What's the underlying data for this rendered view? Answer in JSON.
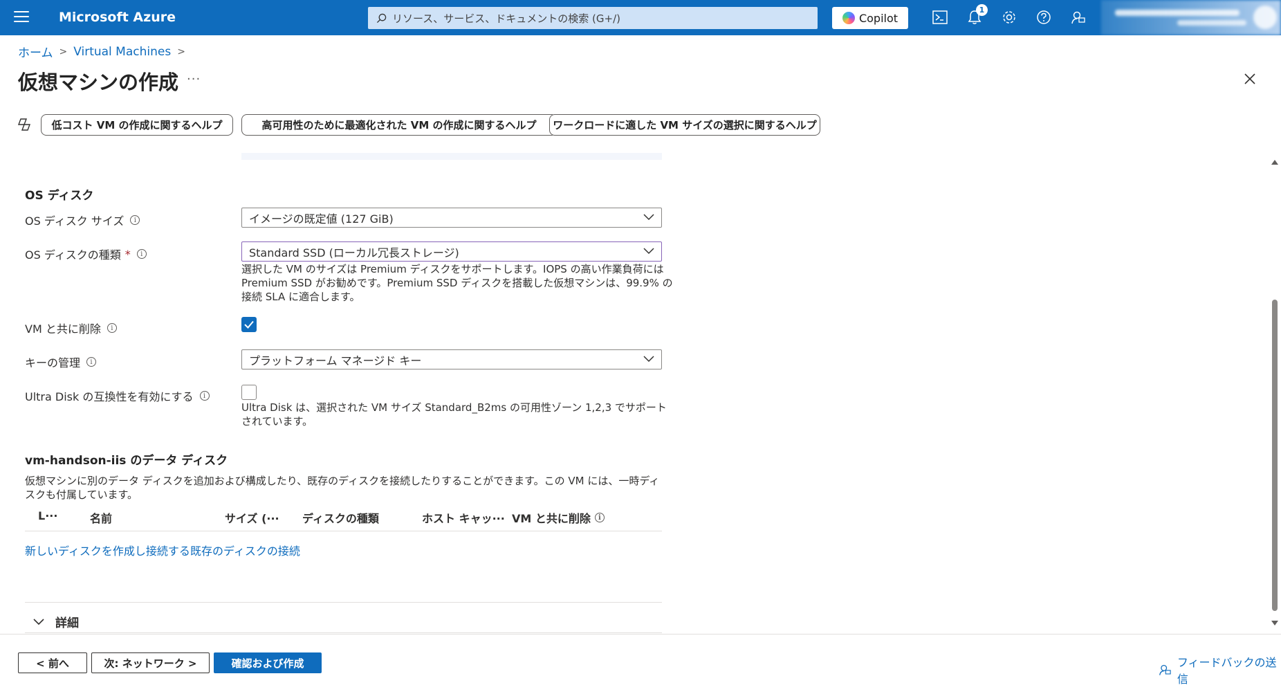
{
  "header": {
    "brand": "Microsoft Azure",
    "search_placeholder": "リソース、サービス、ドキュメントの検索 (G+/)",
    "copilot_label": "Copilot",
    "notification_count": "1"
  },
  "breadcrumb": {
    "home": "ホーム",
    "vm": "Virtual Machines"
  },
  "page": {
    "title": "仮想マシンの作成",
    "more": "···"
  },
  "help_pills": [
    "低コスト VM の作成に関するヘルプ",
    "高可用性のために最適化された VM の作成に関するヘルプ",
    "ワークロードに適した VM サイズの選択に関するヘルプ"
  ],
  "os_disk": {
    "heading": "OS ディスク",
    "size_label": "OS ディスク サイズ",
    "size_value": "イメージの既定値 (127 GiB)",
    "type_label": "OS ディスクの種類",
    "type_required": "*",
    "type_value": "Standard SSD (ローカル冗長ストレージ)",
    "type_help_1": "選択した VM のサイズは Premium ディスクをサポートします。IOPS の高い作業負荷には",
    "type_help_2": "Premium SSD がお勧めです。Premium SSD ディスクを搭載した仮想マシンは、99.9% の",
    "type_help_3": "接続 SLA に適合します。",
    "delete_label": "VM と共に削除",
    "delete_checked": true,
    "key_label": "キーの管理",
    "key_value": "プラットフォーム マネージド キー",
    "ultra_label": "Ultra Disk の互換性を有効にする",
    "ultra_checked": false,
    "ultra_help_1": "Ultra Disk は、選択された VM サイズ Standard_B2ms の可用性ゾーン 1,2,3 でサポート",
    "ultra_help_2": "されています。"
  },
  "data_disks": {
    "heading": "vm-handson-iis のデータ ディスク",
    "desc": "仮想マシンに別のデータ ディスクを追加および構成したり、既存のディスクを接続したりすることができます。この VM には、一時ディスクも付属しています。",
    "columns": [
      "L···",
      "名前",
      "サイズ (···",
      "ディスクの種類",
      "ホスト キャッ···",
      "VM と共に削除"
    ],
    "create_link": "新しいディスクを作成し接続する",
    "attach_link": "既存のディスクの接続",
    "details_label": "詳細"
  },
  "footer": {
    "prev": "< 前へ",
    "next": "次: ネットワーク >",
    "review": "確認および作成",
    "feedback": "フィードバックの送信"
  },
  "colors": {
    "brand_blue": "#0f6cbd",
    "focus_purple": "#8764b8"
  }
}
